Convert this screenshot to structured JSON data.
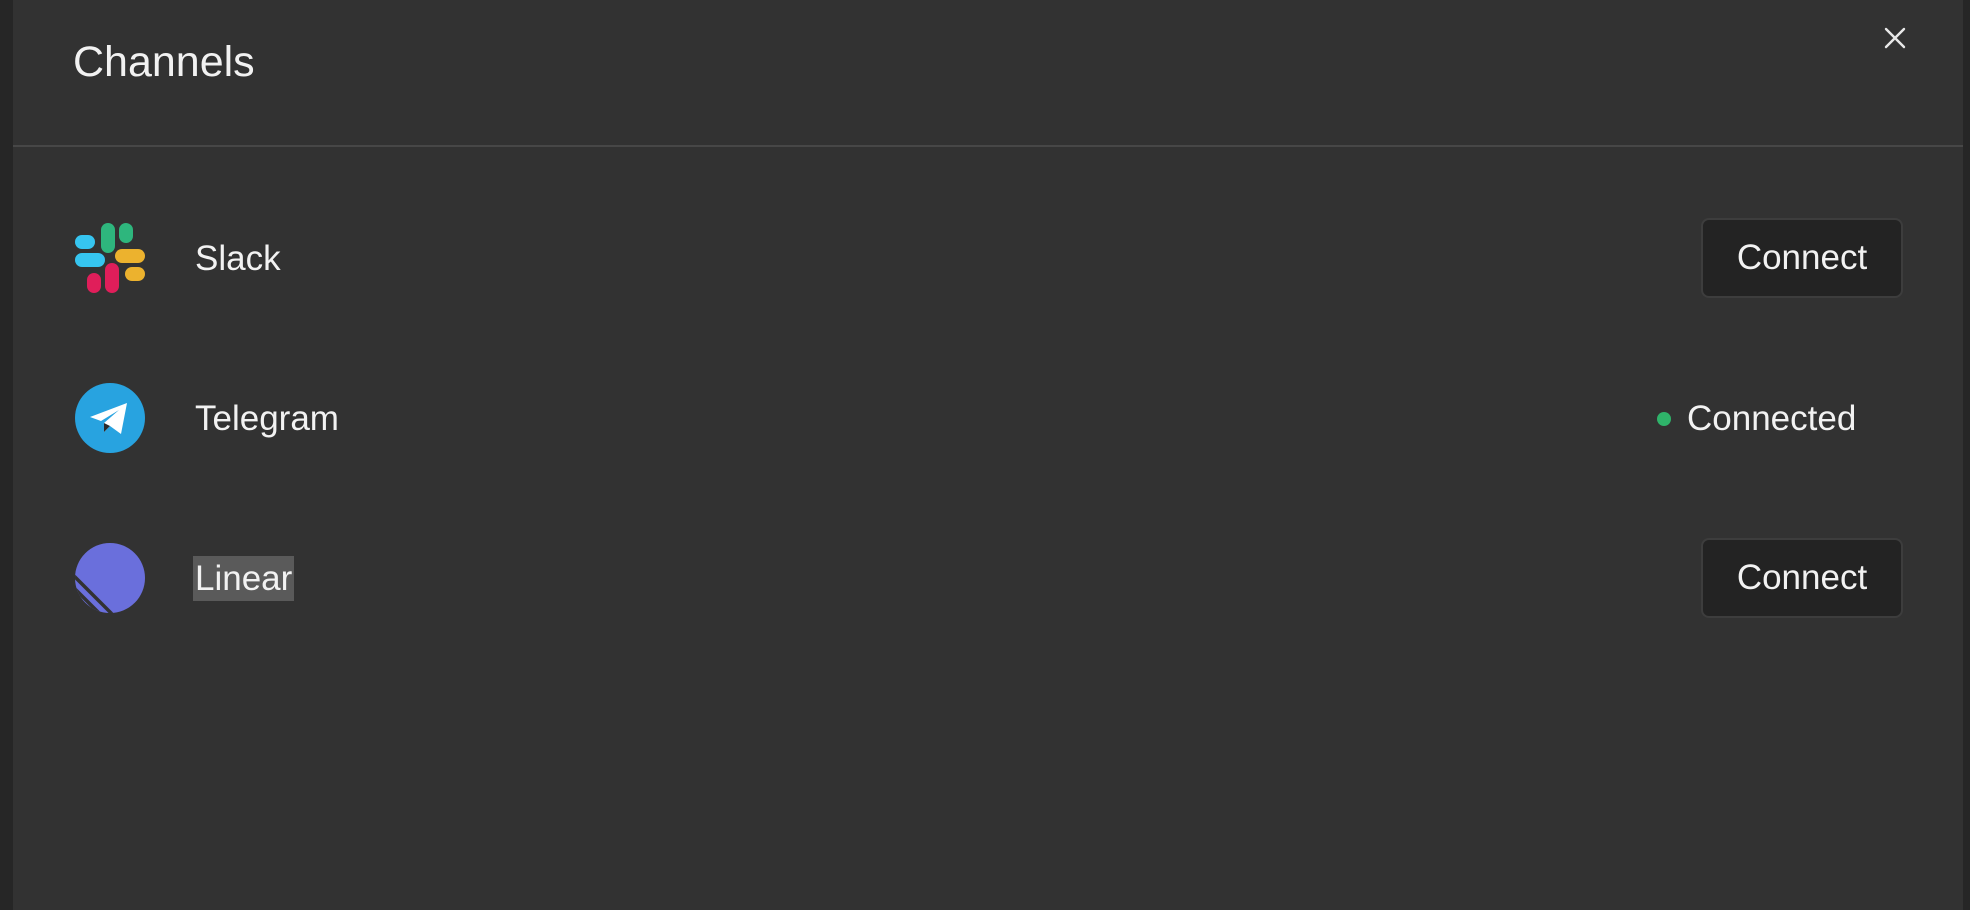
{
  "dialog": {
    "title": "Channels",
    "close_icon": "close-icon"
  },
  "channels": [
    {
      "name": "Slack",
      "icon": "slack-icon",
      "state": "disconnected",
      "action_label": "Connect"
    },
    {
      "name": "Telegram",
      "icon": "telegram-icon",
      "state": "connected",
      "status_label": "Connected"
    },
    {
      "name": "Linear",
      "icon": "linear-icon",
      "state": "disconnected",
      "action_label": "Connect",
      "text_selected": true
    }
  ],
  "colors": {
    "dialog_background": "#323232",
    "button_background": "#232323",
    "connected_dot": "#2fb36a",
    "telegram_blue": "#28a3e0",
    "linear_purple": "#6a6fdc",
    "slack_blue": "#36c5f0",
    "slack_green": "#2eb67d",
    "slack_red": "#e01e5a",
    "slack_yellow": "#ecb22e"
  }
}
